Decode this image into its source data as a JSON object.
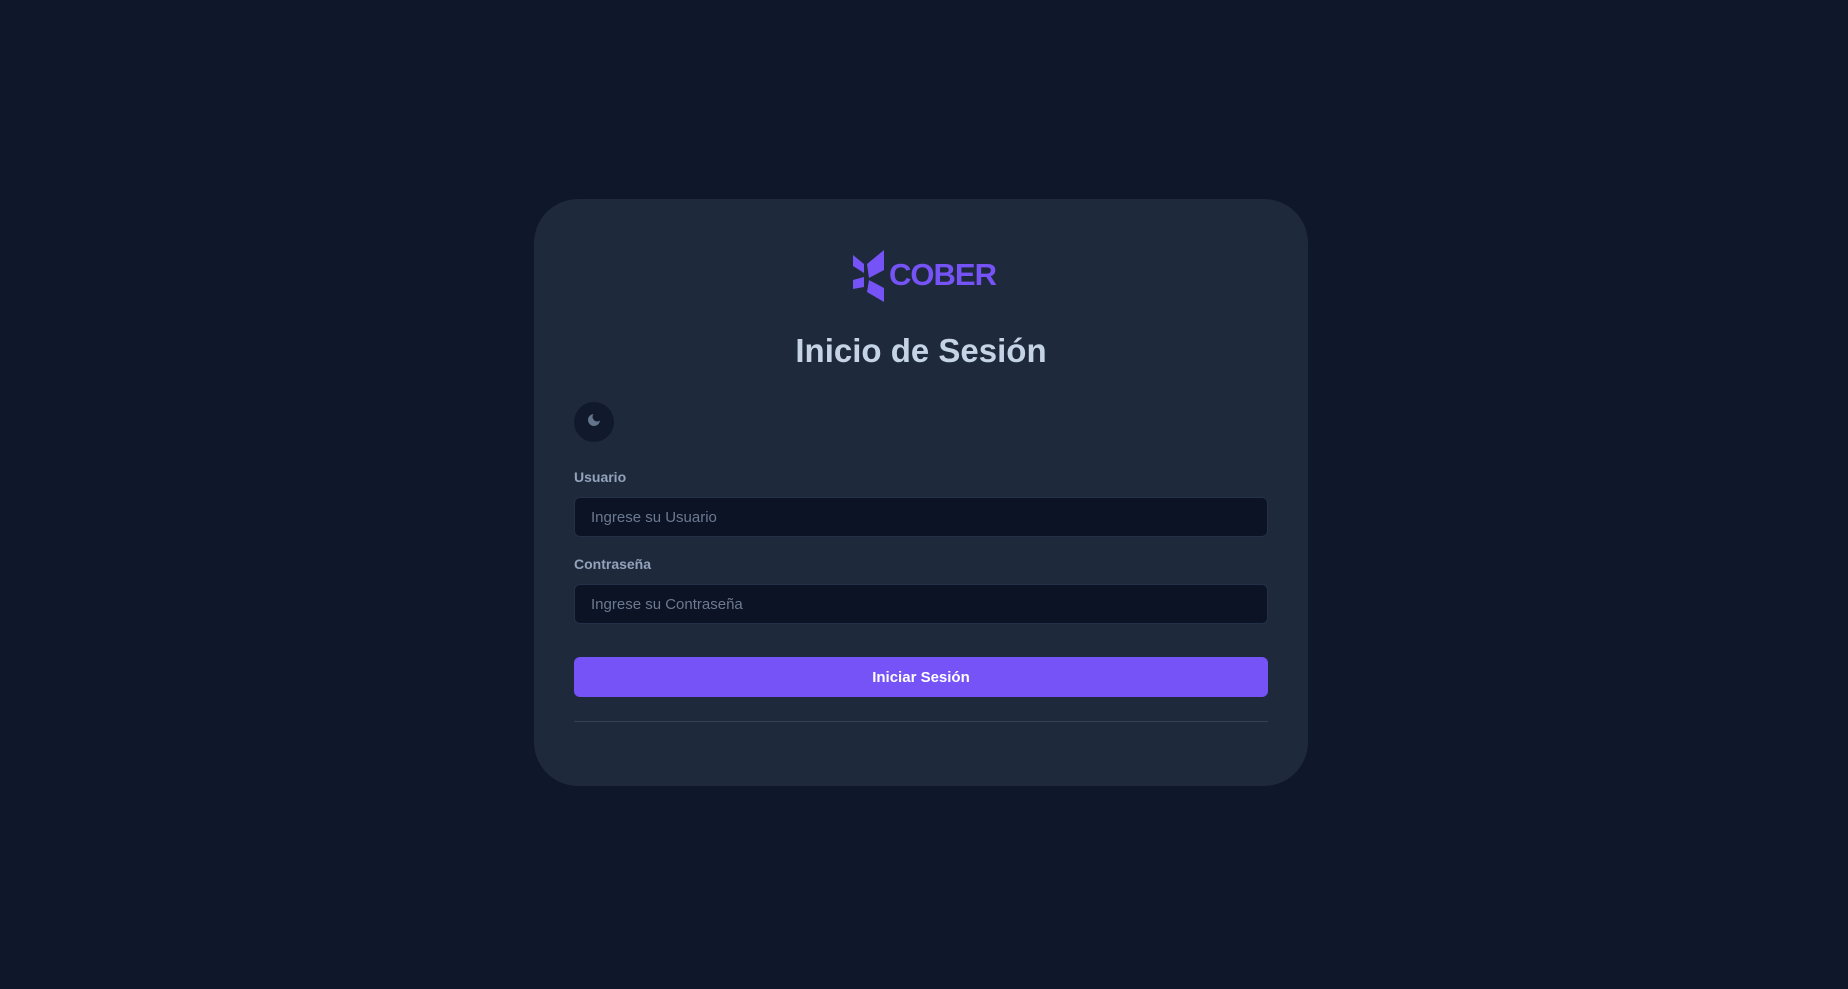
{
  "logo": {
    "text": "COBER",
    "color": "#7553f6"
  },
  "page": {
    "title": "Inicio de Sesión"
  },
  "theme_toggle": {
    "icon": "moon-icon"
  },
  "form": {
    "username": {
      "label": "Usuario",
      "placeholder": "Ingrese su Usuario",
      "value": ""
    },
    "password": {
      "label": "Contraseña",
      "placeholder": "Ingrese su Contraseña",
      "value": ""
    },
    "submit_label": "Iniciar Sesión"
  },
  "colors": {
    "background": "#0f172a",
    "card": "#1e293b",
    "accent": "#7553f6",
    "input_background": "#0c1325"
  }
}
